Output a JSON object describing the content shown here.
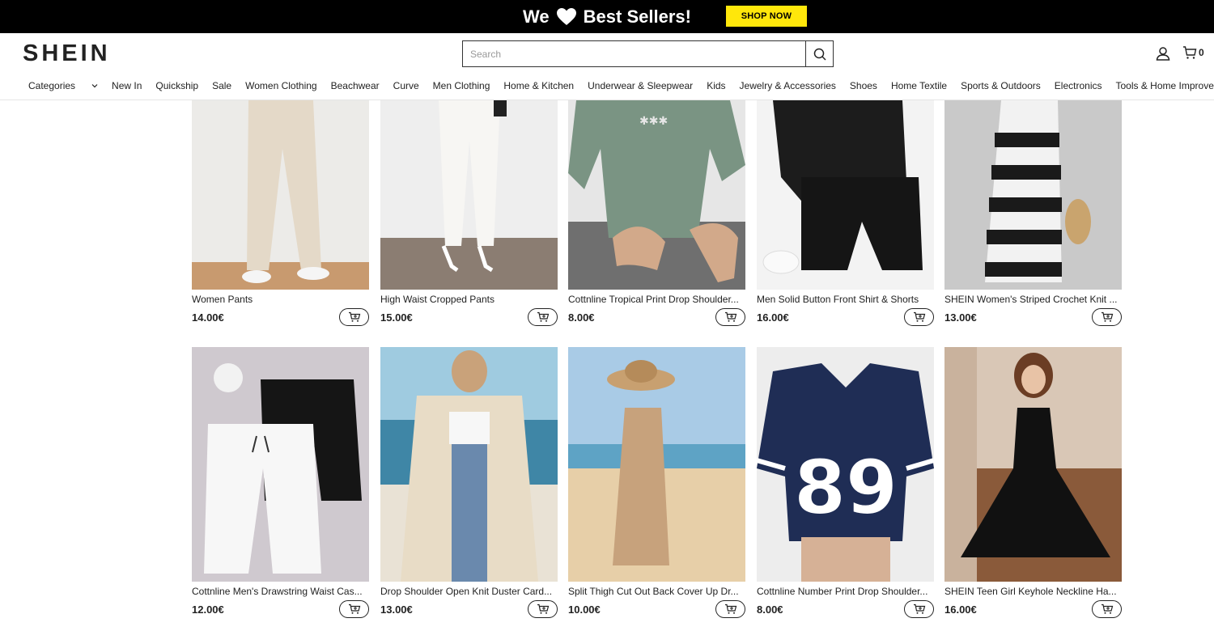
{
  "promo": {
    "text_left": "We",
    "text_right": "Best Sellers!",
    "button": "SHOP NOW"
  },
  "header": {
    "logo": "SHEIN",
    "search_placeholder": "Search",
    "cart_count": "0",
    "nav": [
      "Categories",
      "New In",
      "Quickship",
      "Sale",
      "Women Clothing",
      "Beachwear",
      "Curve",
      "Men Clothing",
      "Home & Kitchen",
      "Underwear & Sleepwear",
      "Kids",
      "Jewelry & Accessories",
      "Shoes",
      "Home Textile",
      "Sports & Outdoors",
      "Electronics",
      "Tools & Home Improvement"
    ]
  },
  "products": [
    {
      "title": "Women Pants",
      "price": "14.00€"
    },
    {
      "title": "High Waist Cropped Pants",
      "price": "15.00€"
    },
    {
      "title": "Cottnline Tropical Print Drop Shoulder...",
      "price": "8.00€"
    },
    {
      "title": "Men Solid Button Front Shirt & Shorts",
      "price": "16.00€"
    },
    {
      "title": "SHEIN Women's Striped Crochet Knit ...",
      "price": "13.00€"
    },
    {
      "title": "Cottnline Men's Drawstring Waist Cas...",
      "price": "12.00€"
    },
    {
      "title": "Drop Shoulder Open Knit Duster Card...",
      "price": "13.00€"
    },
    {
      "title": "Split Thigh Cut Out Back Cover Up Dr...",
      "price": "10.00€"
    },
    {
      "title": "Cottnline Number Print Drop Shoulder...",
      "price": "8.00€"
    },
    {
      "title": "SHEIN Teen Girl Keyhole Neckline Ha...",
      "price": "16.00€"
    }
  ],
  "jersey_number": "89"
}
